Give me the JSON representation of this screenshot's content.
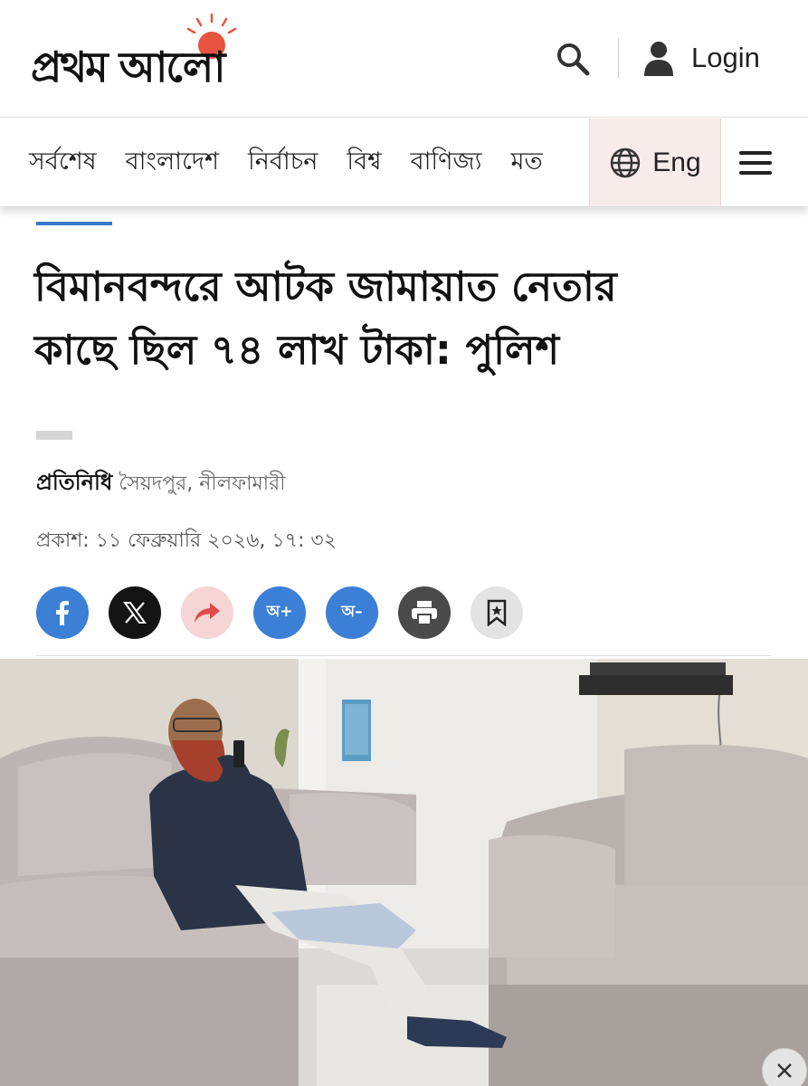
{
  "header": {
    "logo_text": "প্রথম আলো",
    "search_icon": "search-icon",
    "login_label": "Login",
    "user_icon": "user-icon"
  },
  "nav": {
    "items": [
      "সর্বশেষ",
      "বাংলাদেশ",
      "নির্বাচন",
      "বিশ্ব",
      "বাণিজ্য",
      "মত"
    ],
    "language_label": "Eng",
    "globe_icon": "globe-icon",
    "menu_icon": "hamburger-menu-icon"
  },
  "article": {
    "headline_line1": "বিমানবন্দরে আটক জামায়াত নেতার",
    "headline_line2": "কাছে ছিল ৭৪ লাখ টাকা: পুলিশ",
    "author": "প্রতিনিধি",
    "location": "সৈয়দপুর, নীলফামারী",
    "published": "প্রকাশ: ১১ ফেব্রুয়ারি ২০২৬, ১৭: ৩২"
  },
  "share": {
    "font_increase_label": "অ+",
    "font_decrease_label": "অ–",
    "icons": [
      "facebook-icon",
      "x-icon",
      "share-forward-icon",
      "font-increase-icon",
      "font-decrease-icon",
      "print-icon",
      "bookmark-icon"
    ]
  },
  "colors": {
    "accent": "#3a78c9",
    "logo_sun": "#e8533f",
    "lang_bg": "#f8ecea"
  }
}
